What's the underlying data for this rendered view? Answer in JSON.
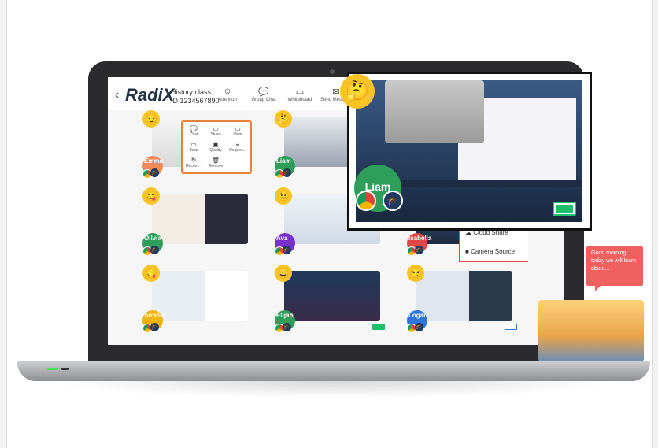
{
  "app": {
    "logo": "RadiX",
    "back": "‹",
    "class_title": "History class",
    "class_id": "ID 1234567890"
  },
  "toolbar": [
    {
      "label": "Attention",
      "icon": "☺"
    },
    {
      "label": "Group Chat",
      "icon": "💬"
    },
    {
      "label": "Whiteboard",
      "icon": "▭"
    },
    {
      "label": "Send Message",
      "icon": "✉"
    }
  ],
  "context_menu": [
    {
      "label": "Chat",
      "icon": "💬"
    },
    {
      "label": "Share",
      "icon": "▭"
    },
    {
      "label": "View",
      "icon": "▭"
    },
    {
      "label": "Tabs",
      "icon": "▭"
    },
    {
      "label": "Quality",
      "icon": "▣"
    },
    {
      "label": "Reques...",
      "icon": "≡"
    },
    {
      "label": "Recom...",
      "icon": "↻"
    },
    {
      "label": "Remove",
      "icon": "🗑"
    }
  ],
  "share_menu": [
    {
      "label": "Cloud Share",
      "icon": "☁"
    },
    {
      "label": "Camera Source",
      "icon": "■"
    }
  ],
  "students": [
    {
      "name": "Emma",
      "emoji": "😏",
      "avatar_color": "#f08a5d",
      "battery_color": "#f08a3a"
    },
    {
      "name": "Liam",
      "emoji": "🤔",
      "avatar_color": "#2f9e5b",
      "battery_color": "#1cc06a"
    },
    {
      "name": "Olivia",
      "emoji": "😋",
      "avatar_color": "#2f9e5b",
      "battery_color": "#1cc06a"
    },
    {
      "name": "Ava",
      "emoji": "😉",
      "avatar_color": "#7a2fd1",
      "battery_color": "#7a2fd1"
    },
    {
      "name": "Isabella",
      "emoji": "😀",
      "avatar_color": "#e04646",
      "battery_color": "#7a2fd1"
    },
    {
      "name": "Sophia",
      "emoji": "😋",
      "avatar_color": "#f0b400",
      "battery_color": "#f0b400"
    },
    {
      "name": "Elijah",
      "emoji": "😄",
      "avatar_color": "#2f9e5b",
      "battery_color": "#1cc06a"
    },
    {
      "name": "Logan",
      "emoji": "😏",
      "avatar_color": "#2d74e0",
      "battery_color": "#2d74e0"
    }
  ],
  "zoom": {
    "name": "Liam",
    "emoji": "🤔"
  },
  "teacher_message": "Good morning, today we will learn about..."
}
